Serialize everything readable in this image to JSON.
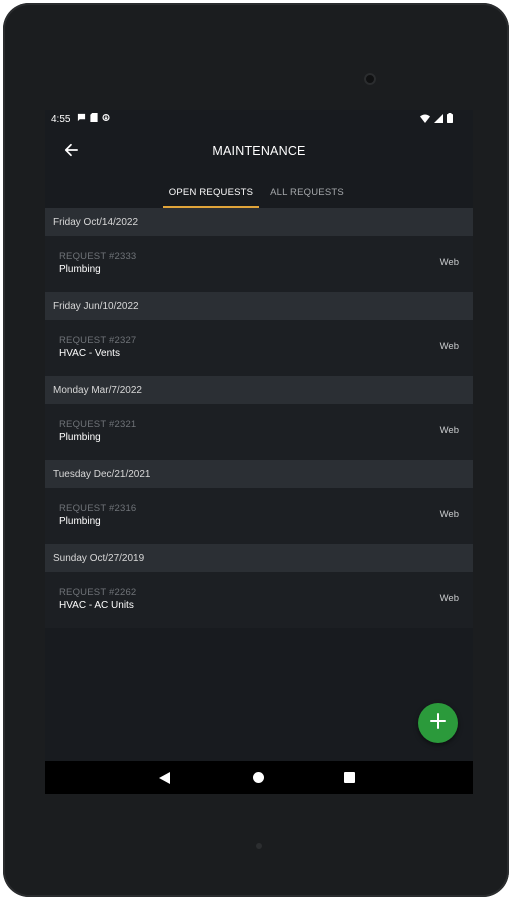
{
  "status_bar": {
    "time": "4:55",
    "left_icons": [
      "chat-icon",
      "sd-card-icon",
      "download-icon"
    ],
    "right_icons": [
      "wifi-icon",
      "signal-icon",
      "battery-icon"
    ]
  },
  "app_bar": {
    "title": "MAINTENANCE",
    "back_icon": "arrow-left-icon"
  },
  "tabs": [
    {
      "label": "OPEN REQUESTS",
      "selected": true
    },
    {
      "label": "ALL REQUESTS",
      "selected": false
    }
  ],
  "colors": {
    "accent": "#e0a43a",
    "fab": "#2b9a3b",
    "background": "#181b1f",
    "header_bg": "#2b2f34"
  },
  "requests": [
    {
      "date": "Friday Oct/14/2022",
      "number": "REQUEST #2333",
      "category": "Plumbing",
      "source": "Web"
    },
    {
      "date": "Friday Jun/10/2022",
      "number": "REQUEST #2327",
      "category": "HVAC - Vents",
      "source": "Web"
    },
    {
      "date": "Monday Mar/7/2022",
      "number": "REQUEST #2321",
      "category": "Plumbing",
      "source": "Web"
    },
    {
      "date": "Tuesday Dec/21/2021",
      "number": "REQUEST #2316",
      "category": "Plumbing",
      "source": "Web"
    },
    {
      "date": "Sunday Oct/27/2019",
      "number": "REQUEST #2262",
      "category": "HVAC - AC Units",
      "source": "Web"
    }
  ],
  "fab": {
    "icon": "plus-icon"
  },
  "nav_bar": {
    "icons": [
      "nav-back-icon",
      "nav-home-icon",
      "nav-recents-icon"
    ]
  }
}
